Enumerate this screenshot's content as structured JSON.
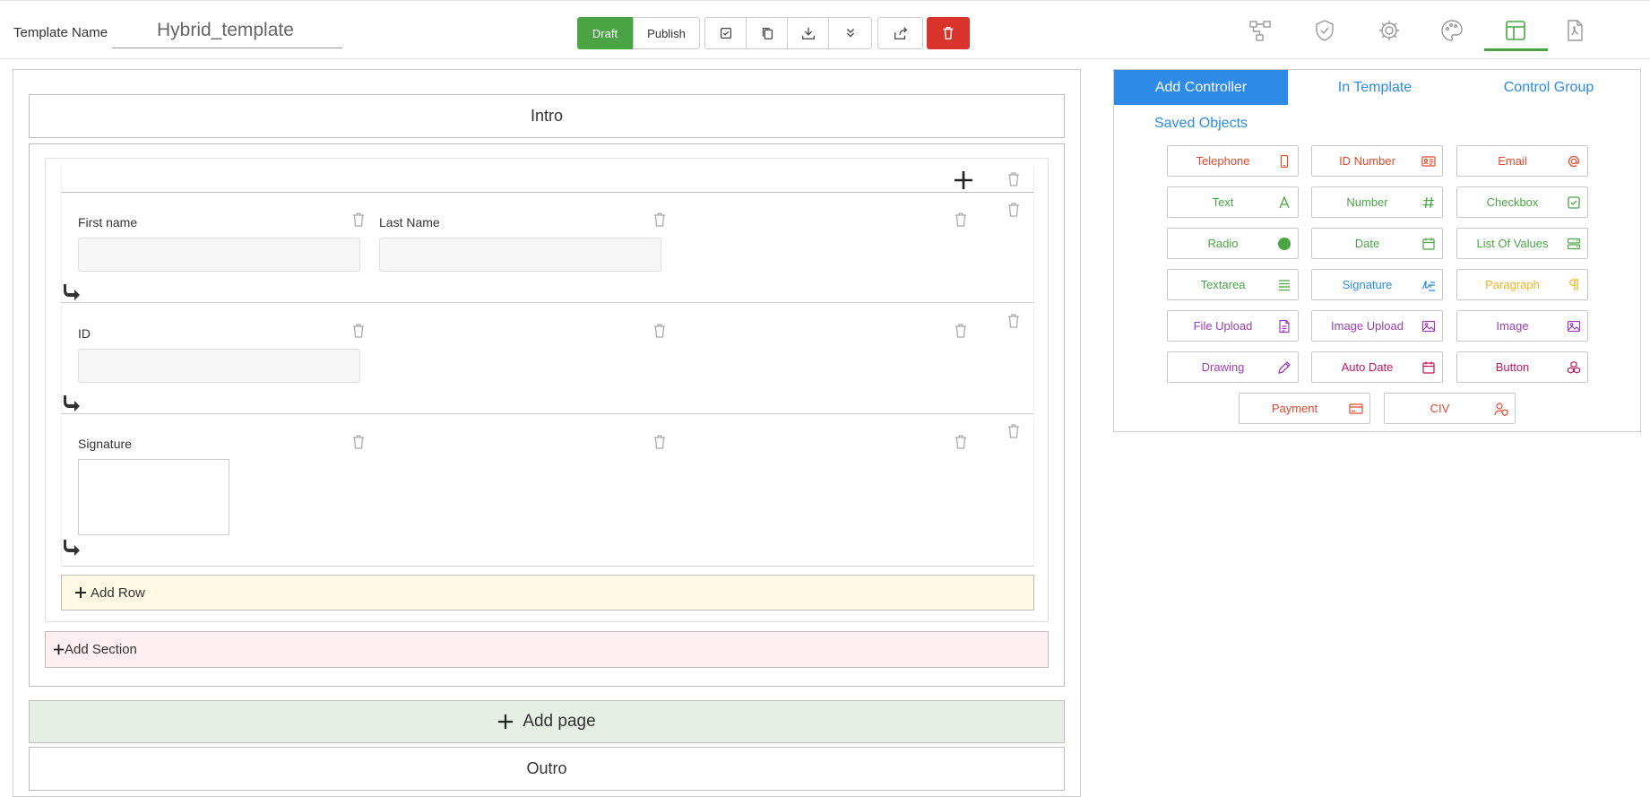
{
  "header": {
    "template_label": "Template Name",
    "template_name": "Hybrid_template",
    "draft_label": "Draft",
    "publish_label": "Publish",
    "toolbar_icons": [
      "validate-icon",
      "copy-icon",
      "download-icon",
      "expand-icon",
      "share-icon",
      "delete-icon"
    ],
    "right_icons": [
      "workflow-icon",
      "shield-icon",
      "gear-icon",
      "palette-icon",
      "layout-icon",
      "pdf-icon"
    ]
  },
  "canvas": {
    "intro_label": "Intro",
    "outro_label": "Outro",
    "rows": [
      {
        "fields": [
          {
            "label": "First name",
            "type": "text"
          },
          {
            "label": "Last Name",
            "type": "text"
          }
        ]
      },
      {
        "fields": [
          {
            "label": "ID",
            "type": "text"
          }
        ]
      },
      {
        "fields": [
          {
            "label": "Signature",
            "type": "signature"
          }
        ]
      }
    ],
    "add_row_label": "Add Row",
    "add_section_label": "Add Section",
    "add_page_label": "Add page"
  },
  "panel": {
    "tabs": [
      {
        "label": "Add Controller",
        "active": true
      },
      {
        "label": "In Template",
        "active": false
      },
      {
        "label": "Control Group",
        "active": false
      },
      {
        "label": "Saved Objects",
        "active": false
      }
    ],
    "controls": [
      {
        "label": "Telephone",
        "icon": "phone-icon",
        "color": "#e24a2e"
      },
      {
        "label": "ID Number",
        "icon": "id-card-icon",
        "color": "#e24a2e"
      },
      {
        "label": "Email",
        "icon": "at-icon",
        "color": "#e24a2e"
      },
      {
        "label": "Text",
        "icon": "text-a-icon",
        "color": "#4aa444"
      },
      {
        "label": "Number",
        "icon": "hash-icon",
        "color": "#4aa444"
      },
      {
        "label": "Checkbox",
        "icon": "checkbox-icon",
        "color": "#4aa444"
      },
      {
        "label": "Radio",
        "icon": "radio-icon",
        "color": "#4aa444"
      },
      {
        "label": "Date",
        "icon": "calendar-icon",
        "color": "#4aa444"
      },
      {
        "label": "List Of Values",
        "icon": "list-icon",
        "color": "#4aa444"
      },
      {
        "label": "Textarea",
        "icon": "lines-icon",
        "color": "#4aa444"
      },
      {
        "label": "Signature",
        "icon": "signature-icon",
        "color": "#2d8ae6"
      },
      {
        "label": "Paragraph",
        "icon": "pilcrow-icon",
        "color": "#f0b323"
      },
      {
        "label": "File Upload",
        "icon": "file-icon",
        "color": "#9b3fb5"
      },
      {
        "label": "Image Upload",
        "icon": "image-icon",
        "color": "#9b3fb5"
      },
      {
        "label": "Image",
        "icon": "image-icon",
        "color": "#9b3fb5"
      },
      {
        "label": "Drawing",
        "icon": "pencil-icon",
        "color": "#9b3fb5"
      },
      {
        "label": "Auto Date",
        "icon": "calendar-icon",
        "color": "#c2185b"
      },
      {
        "label": "Button",
        "icon": "cubes-icon",
        "color": "#c2185b"
      },
      {
        "label": "Payment",
        "icon": "card-icon",
        "color": "#e24a2e"
      },
      {
        "label": "CIV",
        "icon": "user-shield-icon",
        "color": "#e24a2e"
      }
    ]
  }
}
